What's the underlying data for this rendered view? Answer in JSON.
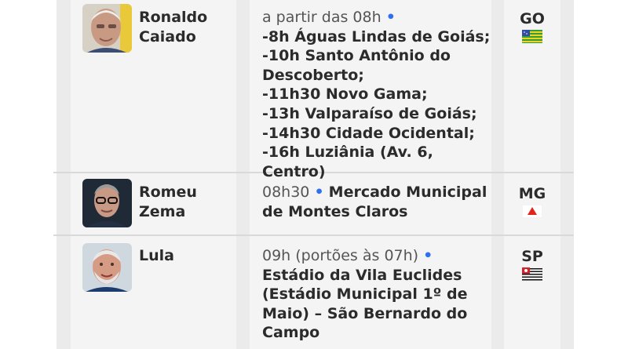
{
  "rows": [
    {
      "name_line1": "Ronaldo",
      "name_line2": "Caiado",
      "time": "a partir das 08h",
      "dot": "•",
      "lines": [
        "-8h Águas Lindas de Goiás;",
        "-10h Santo Antônio do",
        "Descoberto;",
        "-11h30 Novo Gama;",
        "-13h Valparaíso de Goiás;",
        "-14h30 Cidade Ocidental;",
        "-16h Luziânia (Av. 6, Centro)"
      ],
      "state": "GO",
      "flag": "goias-flag-icon"
    },
    {
      "name_line1": "Romeu",
      "name_line2": "Zema",
      "time": "08h30",
      "dot": "•",
      "place_line1": "Mercado Municipal",
      "place_line2": "de Montes Claros",
      "state": "MG",
      "flag": "minas-gerais-flag-icon"
    },
    {
      "name_line1": "Lula",
      "time": "09h (portões às 07h)",
      "dot": "•",
      "lines": [
        "Estádio da Vila Euclides",
        "(Estádio Municipal 1º de",
        "Maio) – São Bernardo do",
        "Campo"
      ],
      "state": "SP",
      "flag": "sao-paulo-flag-icon"
    }
  ],
  "colors": {
    "accent_dot": "#2f6ff0",
    "column_bg": "#f4f4f4",
    "table_bg": "#ebebeb"
  }
}
